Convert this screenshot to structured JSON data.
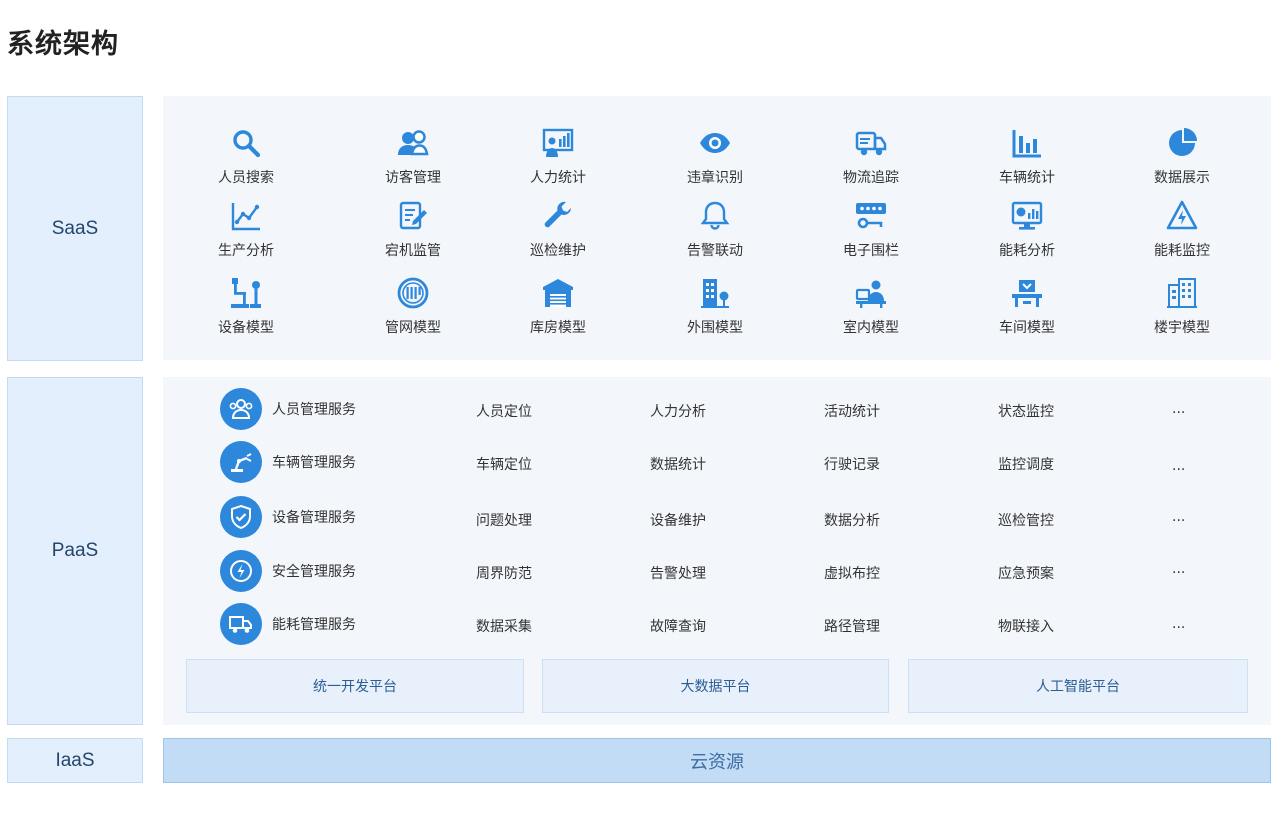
{
  "title": "系统架构",
  "layers": {
    "saas": "SaaS",
    "paas": "PaaS",
    "iaas": "IaaS"
  },
  "saas_modules": [
    {
      "label": "人员搜索",
      "icon": "search-icon"
    },
    {
      "label": "访客管理",
      "icon": "visitors-icon"
    },
    {
      "label": "人力统计",
      "icon": "presentation-icon"
    },
    {
      "label": "违章识别",
      "icon": "eye-icon"
    },
    {
      "label": "物流追踪",
      "icon": "truck-icon"
    },
    {
      "label": "车辆统计",
      "icon": "bar-chart-icon"
    },
    {
      "label": "数据展示",
      "icon": "pie-chart-icon"
    },
    {
      "label": "生产分析",
      "icon": "line-chart-icon"
    },
    {
      "label": "宕机监管",
      "icon": "document-edit-icon"
    },
    {
      "label": "巡检维护",
      "icon": "wrench-icon"
    },
    {
      "label": "告警联动",
      "icon": "bell-icon"
    },
    {
      "label": "电子围栏",
      "icon": "password-key-icon"
    },
    {
      "label": "能耗分析",
      "icon": "monitor-chart-icon"
    },
    {
      "label": "能耗监控",
      "icon": "lightning-warning-icon"
    },
    {
      "label": "设备模型",
      "icon": "robot-arm-icon"
    },
    {
      "label": "管网模型",
      "icon": "valve-icon"
    },
    {
      "label": "库房模型",
      "icon": "warehouse-icon"
    },
    {
      "label": "外围模型",
      "icon": "building-tree-icon"
    },
    {
      "label": "室内模型",
      "icon": "office-worker-icon"
    },
    {
      "label": "车间模型",
      "icon": "workshop-icon"
    },
    {
      "label": "楼宇模型",
      "icon": "buildings-icon"
    }
  ],
  "paas_services": [
    {
      "name": "人员管理服务",
      "icon": "people-icon",
      "items": [
        "人员定位",
        "人力分析",
        "活动统计",
        "状态监控",
        "..."
      ]
    },
    {
      "name": "车辆管理服务",
      "icon": "robot-arm-icon",
      "items": [
        "车辆定位",
        "数据统计",
        "行驶记录",
        "监控调度",
        "..."
      ]
    },
    {
      "name": "设备管理服务",
      "icon": "shield-check-icon",
      "items": [
        "问题处理",
        "设备维护",
        "数据分析",
        "巡检管控",
        "..."
      ]
    },
    {
      "name": "安全管理服务",
      "icon": "lightning-circle-icon",
      "items": [
        "周界防范",
        "告警处理",
        "虚拟布控",
        "应急预案",
        "..."
      ]
    },
    {
      "name": "能耗管理服务",
      "icon": "truck-icon",
      "items": [
        "数据采集",
        "故障查询",
        "路径管理",
        "物联接入",
        "..."
      ]
    }
  ],
  "platforms": [
    "统一开发平台",
    "大数据平台",
    "人工智能平台"
  ],
  "iaas_resource": "云资源",
  "colors": {
    "accent": "#2d87db",
    "label_bg": "#e3effc",
    "panel_bg": "#f3f7fb",
    "iaas_bar": "#c3dcf5"
  }
}
